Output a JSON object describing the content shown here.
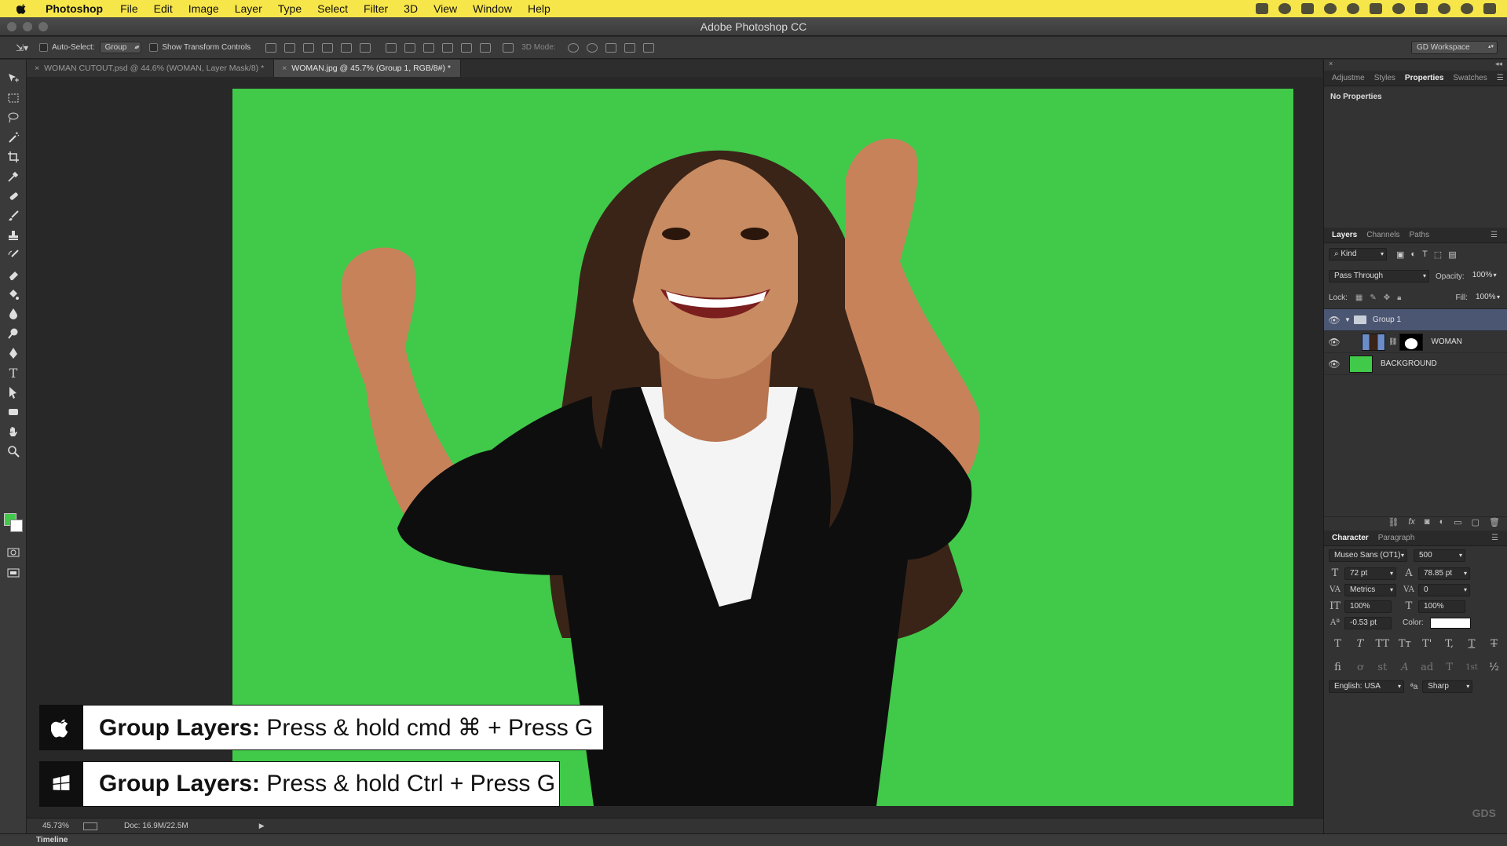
{
  "menubar": {
    "app": "Photoshop",
    "items": [
      "File",
      "Edit",
      "Image",
      "Layer",
      "Type",
      "Select",
      "Filter",
      "3D",
      "View",
      "Window",
      "Help"
    ]
  },
  "window": {
    "title": "Adobe Photoshop CC"
  },
  "options": {
    "auto_select_label": "Auto-Select:",
    "auto_select_value": "Group",
    "transform_label": "Show Transform Controls",
    "mode_3d": "3D Mode:",
    "workspace": "GD Workspace"
  },
  "tabs": [
    {
      "label": "WOMAN CUTOUT.psd @ 44.6% (WOMAN, Layer Mask/8) *",
      "active": false
    },
    {
      "label": "WOMAN.jpg @ 45.7% (Group 1, RGB/8#) *",
      "active": true
    }
  ],
  "status": {
    "zoom": "45.73%",
    "doc": "Doc: 16.9M/22.5M"
  },
  "timeline": "Timeline",
  "shortcuts": {
    "mac": {
      "bold": "Group Layers:",
      "rest": "Press & hold cmd  ⌘  +  Press G"
    },
    "win": {
      "bold": "Group Layers:",
      "rest": "Press & hold Ctrl  +  Press G"
    }
  },
  "properties_panel": {
    "tabs": [
      "Adjustme",
      "Styles",
      "Properties",
      "Swatches"
    ],
    "active": "Properties",
    "content": "No Properties"
  },
  "layers_panel": {
    "tabs": [
      "Layers",
      "Channels",
      "Paths"
    ],
    "active": "Layers",
    "kind": "Kind",
    "blend": "Pass Through",
    "opacity_label": "Opacity:",
    "opacity": "100%",
    "lock_label": "Lock:",
    "fill_label": "Fill:",
    "fill": "100%",
    "layers": [
      {
        "name": "Group 1",
        "type": "group",
        "selected": true
      },
      {
        "name": "WOMAN",
        "type": "masked"
      },
      {
        "name": "BACKGROUND",
        "type": "fill"
      }
    ]
  },
  "character_panel": {
    "tabs": [
      "Character",
      "Paragraph"
    ],
    "active": "Character",
    "font_family": "Museo Sans (OT1)",
    "font_weight": "500",
    "size": "72 pt",
    "leading": "78.85 pt",
    "kerning": "Metrics",
    "tracking": "0",
    "vscale": "100%",
    "hscale": "100%",
    "baseline": "-0.53 pt",
    "color_label": "Color:",
    "language": "English: USA",
    "aa_label": "ªa",
    "antialias": "Sharp",
    "style_buttons": [
      "T",
      "T",
      "TT",
      "Tт",
      "T'",
      "T,",
      "T",
      "T"
    ],
    "otf_buttons": [
      "fi",
      "ơ",
      "st",
      "A",
      "ad",
      "T",
      "1st",
      "½"
    ]
  },
  "watermark": "GDS",
  "colors": {
    "canvas_green": "#41c94a",
    "selection": "#4b5673",
    "menubar": "#f7e64a"
  }
}
